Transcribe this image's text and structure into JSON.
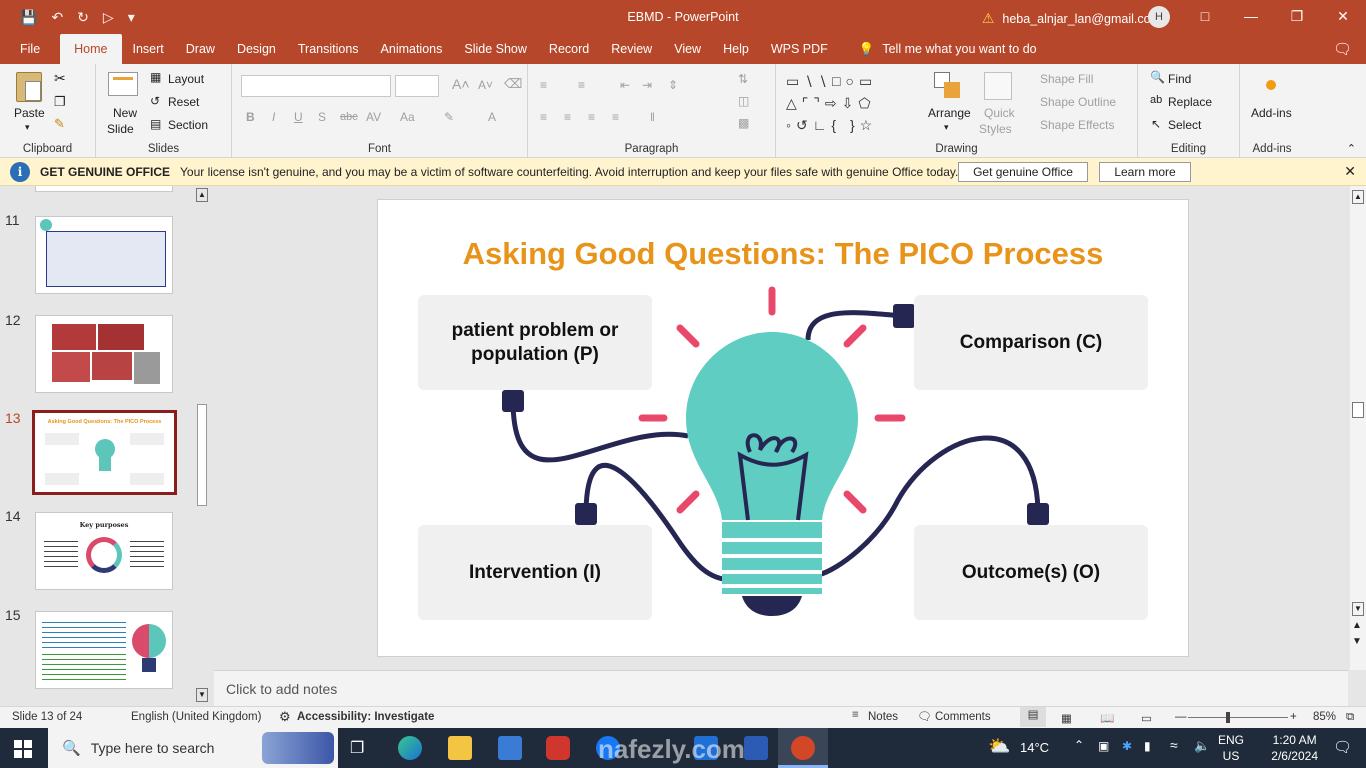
{
  "window": {
    "filename": "EBMD",
    "app": "PowerPoint",
    "account": "heba_alnjar_lan@gmail.com",
    "avatar_letter": "H"
  },
  "tabs": [
    "File",
    "Home",
    "Insert",
    "Draw",
    "Design",
    "Transitions",
    "Animations",
    "Slide Show",
    "Record",
    "Review",
    "View",
    "Help",
    "WPS PDF"
  ],
  "active_tab": "Home",
  "tell_me": "Tell me what you want to do",
  "ribbon": {
    "clipboard": {
      "label": "Clipboard",
      "paste": "Paste"
    },
    "slides": {
      "label": "Slides",
      "new_slide": "New",
      "new_slide2": "Slide",
      "layout": "Layout",
      "reset": "Reset",
      "section": "Section"
    },
    "font": {
      "label": "Font"
    },
    "paragraph": {
      "label": "Paragraph"
    },
    "drawing": {
      "label": "Drawing",
      "arrange": "Arrange",
      "quick_styles": "Quick",
      "quick_styles2": "Styles",
      "shape_fill": "Shape Fill",
      "shape_outline": "Shape Outline",
      "shape_effects": "Shape Effects"
    },
    "editing": {
      "label": "Editing",
      "find": "Find",
      "replace": "Replace",
      "select": "Select"
    },
    "addins": {
      "label": "Add-ins",
      "button": "Add-ins"
    }
  },
  "message_bar": {
    "title": "GET GENUINE OFFICE",
    "text": "Your license isn't genuine, and you may be a victim of software counterfeiting. Avoid interruption and keep your files safe with genuine Office today.",
    "btn_primary": "Get genuine Office",
    "btn_secondary": "Learn more"
  },
  "thumbnails": [
    {
      "num": "11"
    },
    {
      "num": "12"
    },
    {
      "num": "13"
    },
    {
      "num": "14",
      "title": "Key purposes"
    },
    {
      "num": "15"
    }
  ],
  "thumb13_title": "Asking Good Questions: The PICO Process",
  "slide": {
    "title": "Asking Good Questions: The PICO Process",
    "p": "patient problem or population (P)",
    "i": "Intervention (I)",
    "c": "Comparison (C)",
    "o": "Outcome(s) (O)"
  },
  "notes_placeholder": "Click to add notes",
  "status": {
    "slide_count": "Slide 13 of 24",
    "language": "English (United Kingdom)",
    "accessibility": "Accessibility: Investigate",
    "notes": "Notes",
    "comments": "Comments",
    "zoom": "85%"
  },
  "taskbar": {
    "search_placeholder": "Type here to search",
    "weather": "14°C",
    "lang1": "ENG",
    "lang2": "US",
    "time": "1:20 AM",
    "date": "2/6/2024"
  },
  "watermark": "nafezly.com"
}
